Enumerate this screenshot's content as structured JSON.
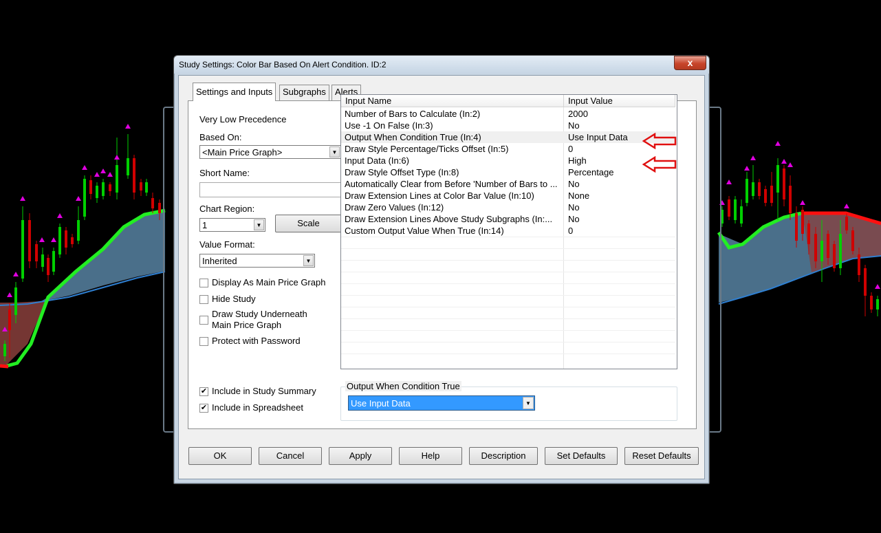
{
  "window": {
    "title": "Study Settings: Color Bar Based On Alert Condition. ID:2",
    "close": "x"
  },
  "tabs": [
    {
      "label": "Settings and Inputs",
      "active": true
    },
    {
      "label": "Subgraphs",
      "active": false
    },
    {
      "label": "Alerts",
      "active": false
    }
  ],
  "settings": {
    "precedence": "Very Low Precedence",
    "based_on_label": "Based On:",
    "based_on_value": "<Main Price Graph>",
    "short_name_label": "Short Name:",
    "short_name_value": "",
    "chart_region_label": "Chart Region:",
    "chart_region_value": "1",
    "scale_button": "Scale",
    "value_format_label": "Value Format:",
    "value_format_value": "Inherited",
    "checkboxes": [
      {
        "label": "Display As Main Price Graph",
        "checked": false
      },
      {
        "label": "Hide Study",
        "checked": false
      },
      {
        "label": "Draw Study Underneath",
        "label2": "Main Price Graph",
        "checked": false
      },
      {
        "label": "Protect with Password",
        "checked": false
      }
    ],
    "bottom_checkboxes": [
      {
        "label": "Include in Study Summary",
        "checked": true
      },
      {
        "label": "Include in Spreadsheet",
        "checked": true
      }
    ]
  },
  "inputs_table": {
    "columns": [
      "Input Name",
      "Input Value"
    ],
    "rows": [
      {
        "name": "Number of Bars to Calculate  (In:2)",
        "value": "2000"
      },
      {
        "name": "Use -1 On False  (In:3)",
        "value": "No"
      },
      {
        "name": "Output When Condition True  (In:4)",
        "value": "Use Input Data",
        "highlight": true
      },
      {
        "name": "Draw Style Percentage/Ticks Offset  (In:5)",
        "value": "0"
      },
      {
        "name": "Input Data  (In:6)",
        "value": "High",
        "highlight": true
      },
      {
        "name": "Draw Style Offset Type  (In:8)",
        "value": "Percentage"
      },
      {
        "name": "Automatically Clear from Before 'Number of Bars to ...",
        "value": "No"
      },
      {
        "name": "Draw Extension Lines at Color Bar Value  (In:10)",
        "value": "None"
      },
      {
        "name": "Draw Zero Values  (In:12)",
        "value": "No"
      },
      {
        "name": "Draw Extension Lines Above Study Subgraphs  (In:...",
        "value": "No"
      },
      {
        "name": "Custom Output Value When True  (In:14)",
        "value": "0"
      }
    ]
  },
  "editor": {
    "group_label": "Output When Condition True",
    "value": "Use Input Data"
  },
  "buttons": [
    "OK",
    "Cancel",
    "Apply",
    "Help",
    "Description",
    "Set Defaults",
    "Reset Defaults"
  ],
  "colors": {
    "annotation_arrow": "#e01010",
    "up_bar": "#00d000",
    "down_bar": "#d00000",
    "alert_marker": "#e000e0",
    "ma_rising": "#22ee22",
    "ma_falling": "#ff1010",
    "band_fill": "#4a6f8a"
  }
}
